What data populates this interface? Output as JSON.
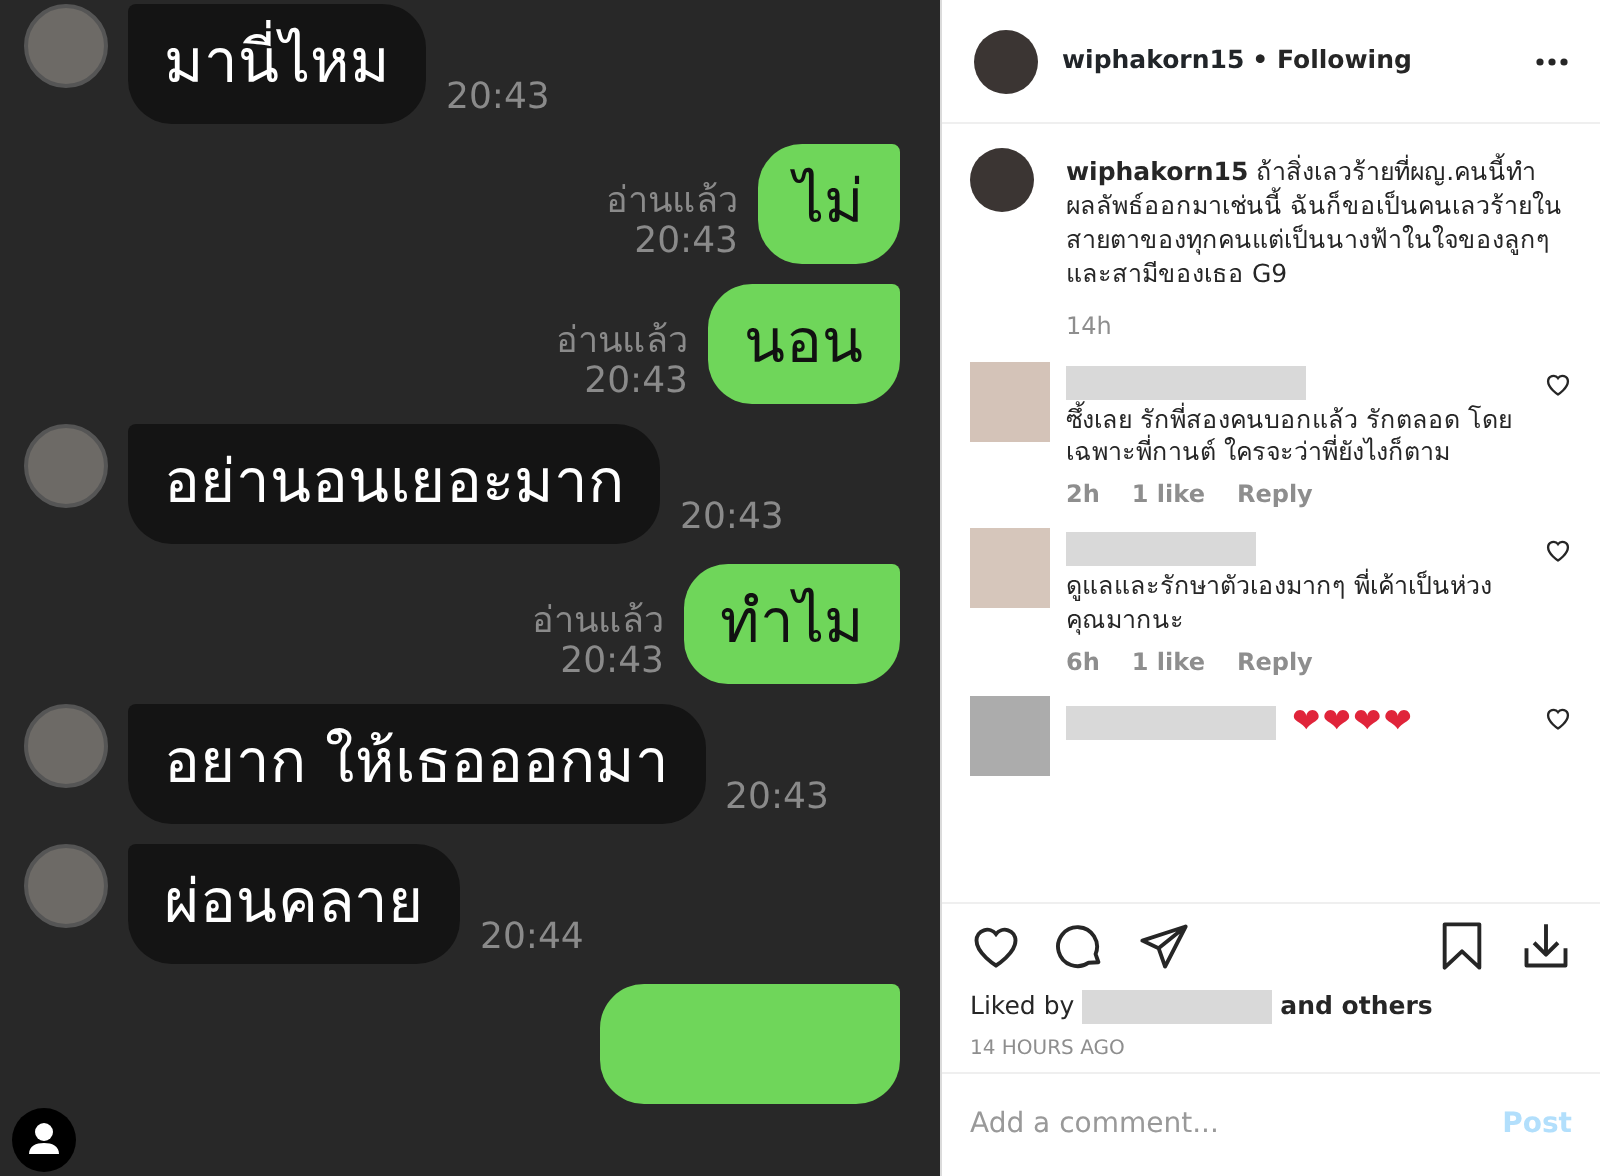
{
  "chat": {
    "messages": [
      {
        "kind": "incoming",
        "text": "มานี่ไหม",
        "time": "20:43"
      },
      {
        "kind": "outgoing",
        "text": "ไม่",
        "read_label": "อ่านแล้ว",
        "time": "20:43"
      },
      {
        "kind": "outgoing",
        "text": "นอน",
        "read_label": "อ่านแล้ว",
        "time": "20:43"
      },
      {
        "kind": "incoming",
        "text": "อย่านอนเยอะมาก",
        "time": "20:43"
      },
      {
        "kind": "outgoing",
        "text": "ทำไม",
        "read_label": "อ่านแล้ว",
        "time": "20:43"
      },
      {
        "kind": "incoming",
        "text": "อยาก ให้เธอออกมา",
        "time": "20:43"
      },
      {
        "kind": "incoming",
        "text": "ผ่อนคลาย",
        "time": "20:44"
      },
      {
        "kind": "outgoing-cut"
      }
    ]
  },
  "post": {
    "header": {
      "username": "wiphakorn15",
      "follow_label": "• Following"
    },
    "caption": {
      "username": "wiphakorn15",
      "text": "ถ้าสิ่งเลวร้ายที่ผญ.คนนี้ทำผลลัพธ์ออกมาเช่นนี้ ฉันก็ขอเป็นคนเลวร้ายในสายตาของทุกคนแต่เป็นนางฟ้าในใจของลูกๆและสามีของเธอ G9",
      "age": "14h"
    },
    "comments": [
      {
        "text": "ซึ้งเลย รักพี่สองคนบอกแล้ว รักตลอด โดยเฉพาะพี่กานต์ ใครจะว่าพี่ยังไงก็ตาม",
        "age": "2h",
        "likes": "1 like",
        "reply_label": "Reply"
      },
      {
        "text": "ดูแลและรักษาตัวเองมากๆ พี่เค้าเป็นห่วงคุณมากนะ",
        "age": "6h",
        "likes": "1 like",
        "reply_label": "Reply"
      },
      {
        "text": "❤❤❤❤"
      }
    ],
    "liked_by": {
      "prefix": "Liked by",
      "suffix": "and others"
    },
    "timestamp": "14 HOURS AGO",
    "comment_field": {
      "placeholder": "Add a comment..."
    },
    "post_button": "Post"
  }
}
